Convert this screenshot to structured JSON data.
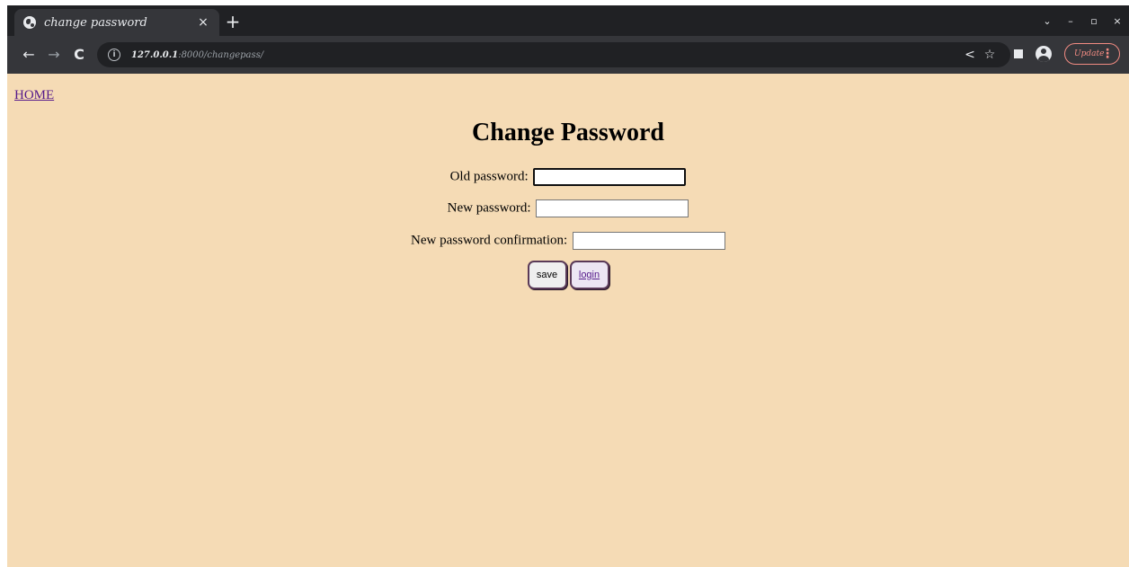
{
  "browser": {
    "tab": {
      "title": "change password",
      "icon": "globe-icon",
      "close_glyph": "×"
    },
    "new_tab_glyph": "+",
    "window_controls": [
      "⌄",
      "–",
      "▫",
      "×"
    ],
    "toolbar": {
      "back_glyph": "←",
      "forward_glyph": "→",
      "reload_glyph": "C",
      "url_host": "127.0.0.1",
      "url_rest": ":8000/changepass/",
      "share_glyph": "<",
      "star_glyph": "☆",
      "update_label": "Update",
      "menu_glyph": "⋮"
    }
  },
  "page": {
    "home_link": "HOME",
    "title": "Change Password",
    "form": {
      "old_password_label": "Old password:",
      "old_password_value": "",
      "new_password_label": "New password:",
      "new_password_value": "",
      "confirm_label": "New password confirmation:",
      "confirm_value": ""
    },
    "buttons": {
      "save": "save",
      "login": "login"
    }
  },
  "colors": {
    "page_background": "#f5dbb5",
    "link": "#551a8b",
    "update_accent": "#f28b82",
    "chrome_dark": "#202124",
    "chrome_toolbar": "#35363a"
  }
}
